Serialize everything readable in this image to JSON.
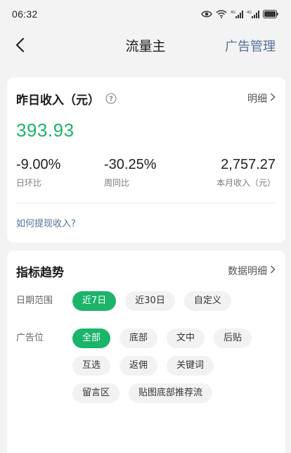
{
  "status": {
    "time": "06:32"
  },
  "nav": {
    "title": "流量主",
    "action": "广告管理"
  },
  "income": {
    "title": "昨日收入（元）",
    "detail_link": "明细",
    "amount": "393.93",
    "stats": [
      {
        "value": "-9.00%",
        "label": "日环比"
      },
      {
        "value": "-30.25%",
        "label": "周同比"
      },
      {
        "value": "2,757.27",
        "label": "本月收入（元）"
      }
    ],
    "withdraw_link": "如何提现收入?"
  },
  "trend": {
    "title": "指标趋势",
    "detail_link": "数据明细",
    "date_label": "日期范围",
    "date_options": [
      "近7日",
      "近30日",
      "自定义"
    ],
    "date_selected": "近7日",
    "position_label": "广告位",
    "position_options": [
      "全部",
      "底部",
      "文中",
      "后贴",
      "互选",
      "返佣",
      "关键词",
      "留言区",
      "贴图底部推荐流"
    ],
    "position_selected": "全部"
  },
  "colors": {
    "accent": "#1bb46a",
    "link": "#54709a",
    "background": "#f3f3f3"
  }
}
